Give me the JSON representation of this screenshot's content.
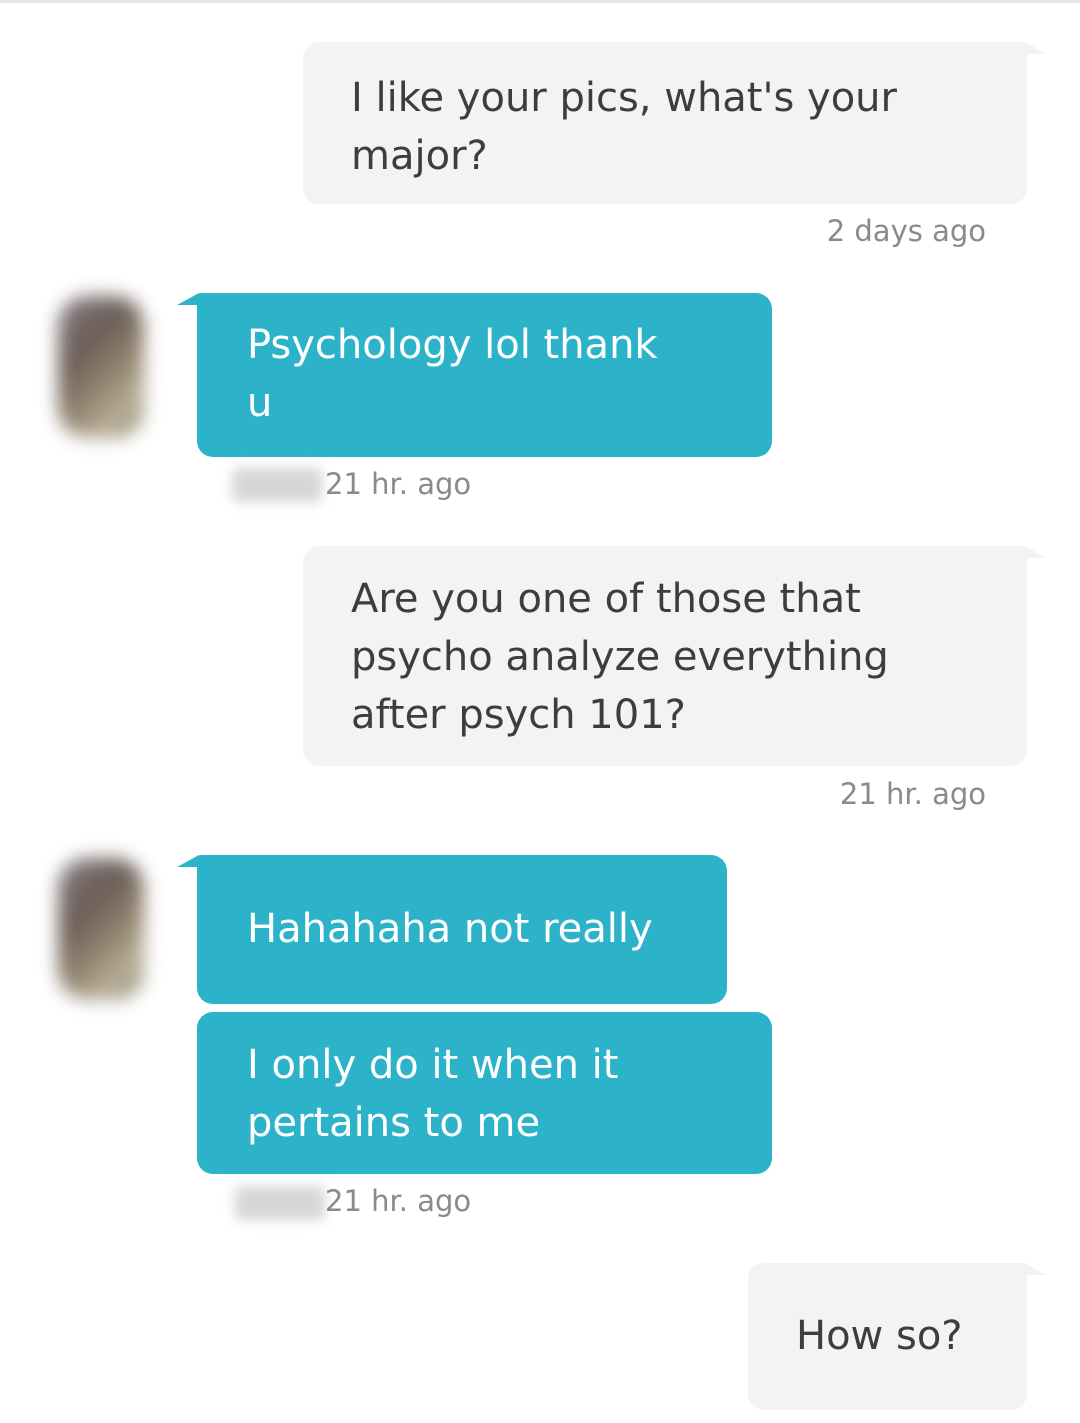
{
  "conversation": {
    "messages": [
      {
        "direction": "sent",
        "text": "I like your pics, what's your\nmajor?"
      },
      {
        "direction": "received",
        "text": "Psychology lol thank\nu"
      },
      {
        "direction": "sent",
        "text": "Are you one of those that\npsycho analyze everything\nafter psych 101?"
      },
      {
        "direction": "received",
        "text": "Hahahaha not really"
      },
      {
        "direction": "received",
        "text": "I only do it when it\npertains to me"
      },
      {
        "direction": "sent",
        "text": "How so?"
      }
    ],
    "timestamps": {
      "t1": "2 days ago",
      "t2": "21 hr. ago",
      "t3": "21 hr. ago",
      "t4": "21 hr. ago"
    }
  },
  "colors": {
    "sent_bubble": "#f3f3f3",
    "received_bubble": "#2db3c9",
    "timestamp_text": "#8a8a8a"
  }
}
